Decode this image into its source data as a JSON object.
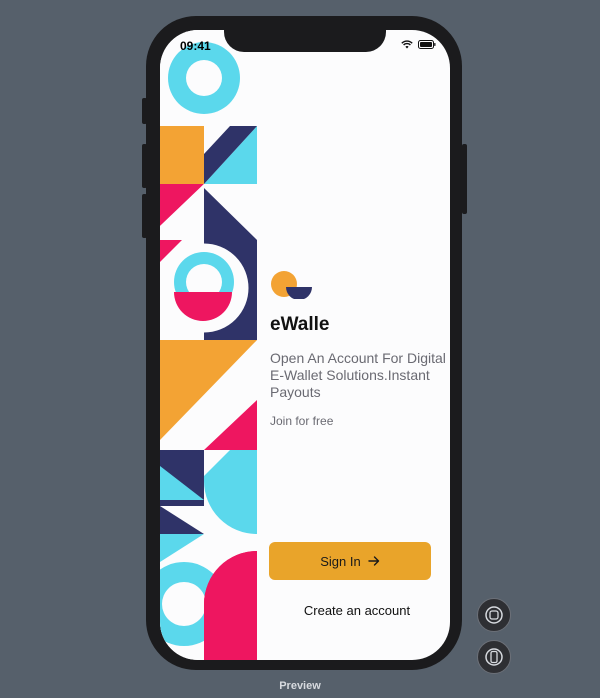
{
  "status_bar": {
    "time": "09:41"
  },
  "app": {
    "name": "eWalle",
    "tagline": "Open An Account For Digital E-Wallet Solutions.Instant Payouts",
    "join_text": "Join for free",
    "sign_in_label": "Sign In",
    "create_account_label": "Create an account"
  },
  "colors": {
    "accent": "#e9a42a",
    "pattern_cyan": "#5bd8ec",
    "pattern_orange": "#f3a334",
    "pattern_pink": "#ee1660",
    "pattern_navy": "#2f3368"
  },
  "icons": [
    "wifi-icon",
    "battery-icon",
    "arrow-right-icon",
    "home-button-icon",
    "device-rotate-icon"
  ],
  "footer": {
    "label": "Preview"
  }
}
